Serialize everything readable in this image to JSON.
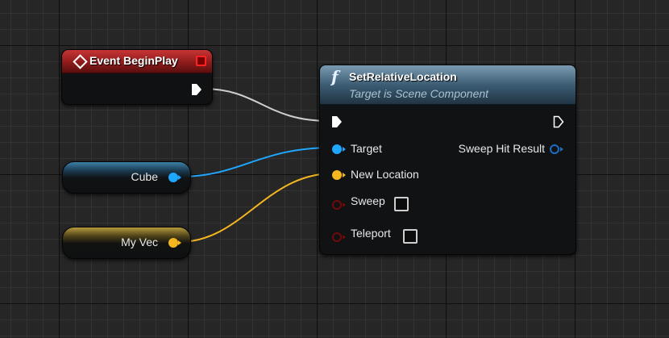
{
  "event_node": {
    "title": "Event BeginPlay",
    "header_color": "#a52a2a"
  },
  "function_node": {
    "icon": "f",
    "title": "SetRelativeLocation",
    "subtitle": "Target is Scene Component",
    "header_color": "#4b6b82",
    "pins": {
      "target": "Target",
      "new_location": "New Location",
      "sweep": "Sweep",
      "teleport": "Teleport",
      "sweep_hit_result": "Sweep Hit Result"
    },
    "checkboxes": {
      "sweep": false,
      "teleport": false
    }
  },
  "variables": [
    {
      "label": "Cube",
      "color": "#1fa7ff"
    },
    {
      "label": "My Vec",
      "color": "#f5b71f"
    }
  ],
  "wire_colors": {
    "exec": "#cfcfcf",
    "object": "#1fa7ff",
    "vector": "#f5b71f"
  }
}
